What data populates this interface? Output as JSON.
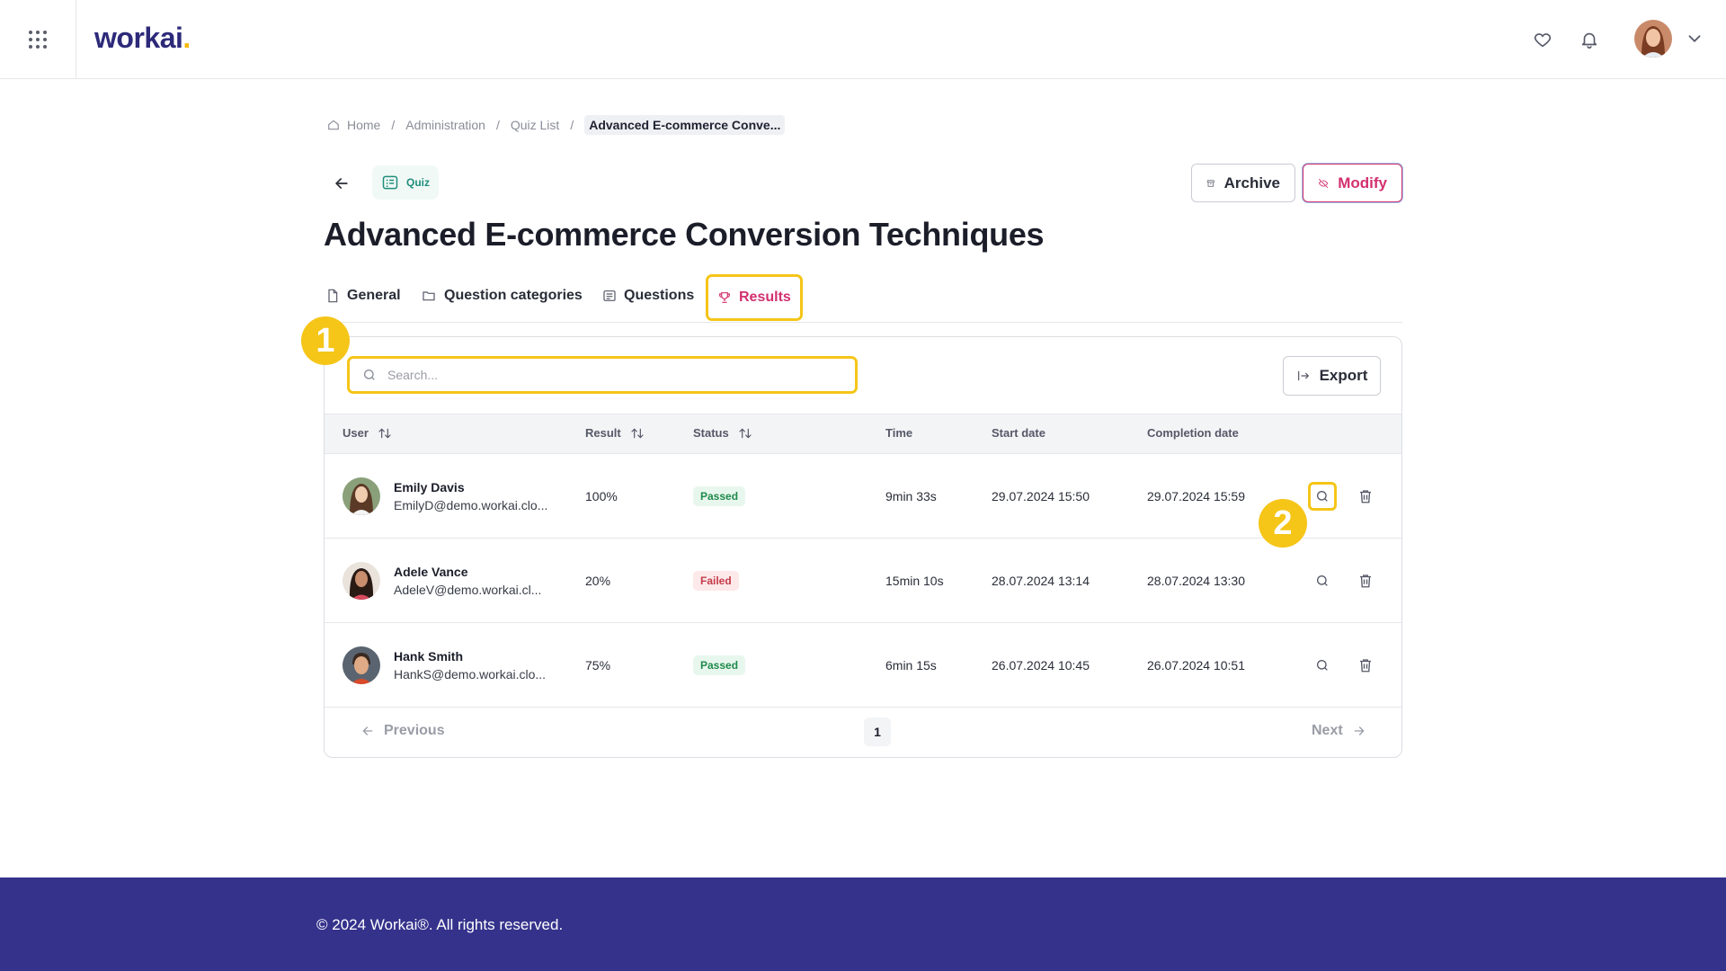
{
  "header": {
    "logo_text": "workai",
    "logo_dot": ".",
    "apps_icon": "grid-icon",
    "favorites_icon": "heart-icon",
    "notifications_icon": "bell-icon",
    "user_menu_icon": "chevron-down-icon"
  },
  "breadcrumb": {
    "home": "Home",
    "sep": "/",
    "items": [
      "Administration",
      "Quiz List"
    ],
    "current": "Advanced E-commerce Conve..."
  },
  "title_row": {
    "badge": "Quiz",
    "archive_label": "Archive",
    "modify_label": "Modify"
  },
  "page_title": "Advanced E-commerce Conversion Techniques",
  "tabs": [
    {
      "label": "General",
      "icon": "document-icon"
    },
    {
      "label": "Question categories",
      "icon": "folder-icon"
    },
    {
      "label": "Questions",
      "icon": "list-icon"
    },
    {
      "label": "Results",
      "icon": "trophy-icon",
      "active": true
    }
  ],
  "results": {
    "search_placeholder": "Search...",
    "export_label": "Export",
    "columns": {
      "user": "User",
      "result": "Result",
      "status": "Status",
      "time": "Time",
      "start": "Start date",
      "completion": "Completion date"
    },
    "rows": [
      {
        "name": "Emily Davis",
        "email": "EmilyD@demo.workai.clo...",
        "result": "100%",
        "status": "Passed",
        "time": "9min 33s",
        "start": "29.07.2024 15:50",
        "completion": "29.07.2024 15:59"
      },
      {
        "name": "Adele Vance",
        "email": "AdeleV@demo.workai.cl...",
        "result": "20%",
        "status": "Failed",
        "time": "15min 10s",
        "start": "28.07.2024 13:14",
        "completion": "28.07.2024 13:30"
      },
      {
        "name": "Hank Smith",
        "email": "HankS@demo.workai.clo...",
        "result": "75%",
        "status": "Passed",
        "time": "6min 15s",
        "start": "26.07.2024 10:45",
        "completion": "26.07.2024 10:51"
      }
    ],
    "pager": {
      "previous": "Previous",
      "page": "1",
      "next": "Next"
    }
  },
  "markers": [
    "1",
    "2"
  ],
  "footer": {
    "text": "© 2024 Workai®. All rights reserved."
  },
  "colors": {
    "accent": "#d3306f",
    "highlight": "#f5c518",
    "footer": "#35328c",
    "brand": "#2d2a7a"
  }
}
